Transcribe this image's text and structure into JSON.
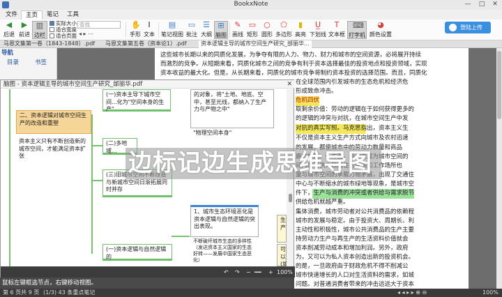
{
  "app": {
    "title": "BookxNote"
  },
  "menu": {
    "tabs": [
      "文件",
      "主页",
      "笔记",
      "工具"
    ],
    "active": 1
  },
  "window_controls": [
    "—",
    "□",
    "✕"
  ],
  "ribbon": {
    "back": "后退",
    "forward": "前进",
    "margin": "边栏",
    "zoom_options": [
      "实际大小",
      "适合宽度",
      "适合页面"
    ],
    "search_placeholder": "查找",
    "hand": "手形",
    "text": "文本",
    "note_view": "笔记视图",
    "comment": "批注",
    "outline": "大纲",
    "mindmap": "脑图",
    "pen": "画线",
    "rect": "矩形",
    "shape": "圆形",
    "polygon": "多边形",
    "highlight": "高亮",
    "underline": "下划线",
    "textbox": "文本框",
    "typewriter": "打字机",
    "color_settings": "颜色设置",
    "login": "登陆上传"
  },
  "doc_tabs": [
    "马恩文集第一卷（1843-1848）.pdf",
    "马恩文集第五卷（资本论1）.pdf",
    "资本逻辑主导的城市空间生产研究_邰丽华..."
  ],
  "nav": {
    "title": "导航",
    "tabs": [
      "目录",
      "书签"
    ]
  },
  "page_text": [
    "这些城市长期以来的同质化发展，为争夺有限的人力、物力、财力和城市的空间资源，必将展开持续",
    "而激烈的竞争。从短期来看，同质化城市之间的竞争有利于资本选择最佳的投资地点和投资领域，实现",
    "资本收益的最大化。但是，从长期来看，同质化的城市竞争将制约资本投资的选择范围。而且，同质化",
    "在全球范围内引发城市的生态危机和经济危",
    "形成致命冲击。",
    "危机四伏",
    "取剩余价值：劳动的逻辑在于如何获得更多的",
    "的逻辑的冲突与对抗，在城市空间生产中发",
    "对抗的真实写照。马克思指出，资本主义生",
    "不仅是资本主义生产方式向城市及农村迅速",
    "的发展，都使城市中的劳动力数量和商品",
    "盾的加剧。一方面，劳动力成为城市空间的",
    "间内的可供人口居住的空间和工作场所也",
    "量与城市空间的承载力相矛盾，出现了交通住",
    "中心与不断缩水的城市绿地等现象，是城市空",
    "件下，生产与消费的冲突或者供给与需求脱节",
    "供给危机就越严重。",
    "集体消费，城市劳动者对公共消费品的依赖程",
    "城市的发展与稳定。由于投资大、周期长、利",
    "主动性和积极性，城市公共消费品的生产主要",
    "持劳动力生产与再生产的生活资料价值就会",
    "资本削减劳动成本和增加利润。另外，政府",
    "为，又可以为私人资本创造出新的投资机会。",
    "的是，一旦政府由于财政危机不得不削减公",
    "城市快速增长的人口对生活资料的需求，如城",
    "问题。对普通消费者带来的冲击远远大于资本",
    "所有者。资本逻辑主导下的城市空间生产，公共消费品的供给与需求的矛盾难以调和，突出体现了资本"
  ],
  "mindmap": {
    "window_title": "脑图 - 资本逻辑主导的城市空间生产研究_邰丽华.pdf",
    "nodes": [
      "(一)资本主导下城市空间...化为\"空间本身的生产\"",
      "二、资本逻辑对城市空间生产的改造和重塑",
      "资本主义只有不断创造新的城市空间，才能满足资本扩张",
      "的对象，将\"土地、地底、空中，甚至光线，都纳入了生产力与产物之中\"",
      "\"物理空间本身\"",
      "(二)多地域...",
      "(三)旧城市空间不断改造与新城市空间日渐拓展同时并存",
      "1、城市生态环境恶化是资本逻辑与自然逻辑的突出表现。",
      "不断破坏城市生态的多样性（发达资本主义国家的生态好转——发展中国家生态恶化）",
      "(一)资本逻辑与自然逻辑的",
      "生产",
      "可以(如)"
    ],
    "zoom": "100%"
  },
  "overlay_caption": "边标记边生成思维导图",
  "hint": "鼠标左键框选节点，右键移动视图。",
  "status": {
    "page": "第 6 页共 9 页",
    "notes": "(1/3) 43 条重点笔记",
    "zoom": "100%"
  }
}
